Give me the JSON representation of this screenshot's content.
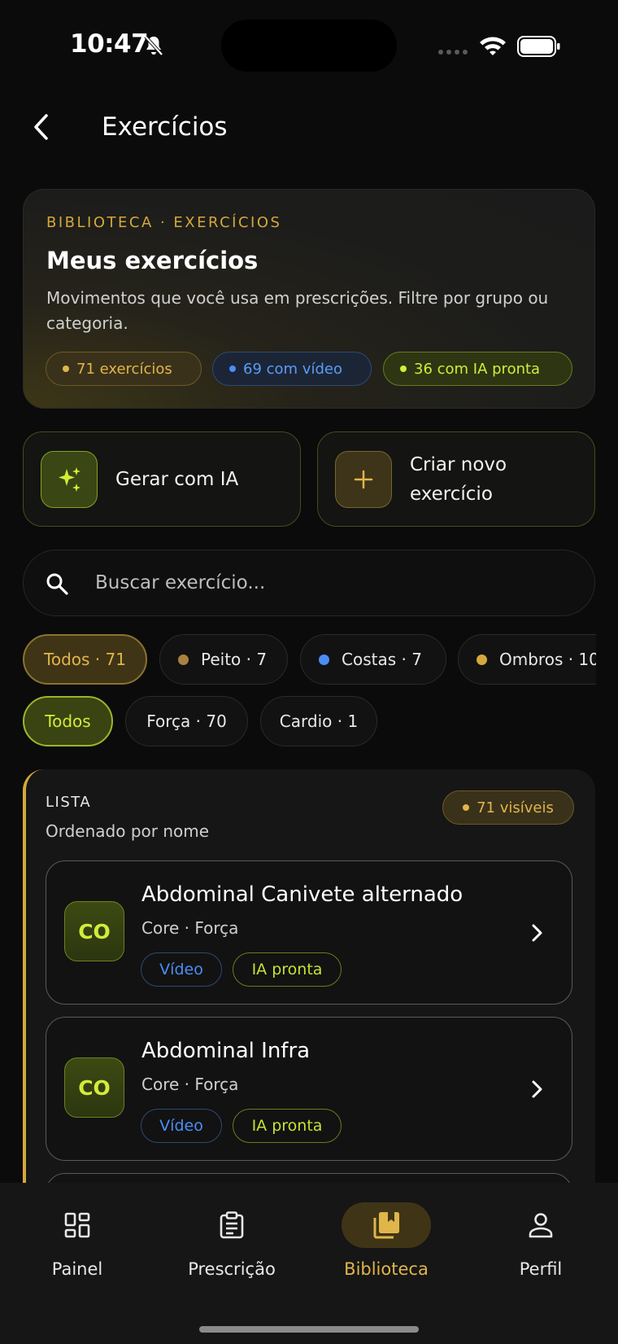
{
  "status_bar": {
    "time": "10:47"
  },
  "header": {
    "title": "Exercícios"
  },
  "hero": {
    "eyebrow": "BIBLIOTECA · EXERCÍCIOS",
    "title": "Meus exercícios",
    "description": "Movimentos que você usa em prescrições. Filtre por grupo ou categoria.",
    "stats": {
      "total": "71 exercícios",
      "video": "69 com vídeo",
      "ia": "36 com IA pronta"
    }
  },
  "actions": {
    "generate_ia": "Gerar com IA",
    "create_new": "Criar novo exercício"
  },
  "search": {
    "placeholder": "Buscar exercício..."
  },
  "group_filters": [
    {
      "label": "Todos · 71",
      "color": "#e0b54a",
      "selected": true
    },
    {
      "label": "Peito · 7",
      "color": "#a8823e"
    },
    {
      "label": "Costas · 7",
      "color": "#4a8ef5"
    },
    {
      "label": "Ombros · 10",
      "color": "#d4a83a"
    }
  ],
  "category_filters": [
    {
      "label": "Todos",
      "selected": true
    },
    {
      "label": "Força · 70"
    },
    {
      "label": "Cardio · 1"
    }
  ],
  "list": {
    "eyebrow": "LISTA",
    "subtitle": "Ordenado por nome",
    "visible_count": "71 visíveis",
    "items": [
      {
        "initials": "CO",
        "name": "Abdominal Canivete alternado",
        "meta": "Core · Força",
        "tag_video": "Vídeo",
        "tag_ia": "IA pronta"
      },
      {
        "initials": "CO",
        "name": "Abdominal Infra",
        "meta": "Core · Força",
        "tag_video": "Vídeo",
        "tag_ia": "IA pronta"
      }
    ]
  },
  "nav": [
    {
      "label": "Painel",
      "icon": "dashboard-icon"
    },
    {
      "label": "Prescrição",
      "icon": "clipboard-icon"
    },
    {
      "label": "Biblioteca",
      "icon": "library-icon",
      "active": true
    },
    {
      "label": "Perfil",
      "icon": "person-icon"
    }
  ],
  "colors": {
    "accent_gold": "#e0b54a",
    "accent_lime": "#d2ec3a",
    "accent_blue": "#4a8ef5",
    "background": "#0b0b0b"
  }
}
